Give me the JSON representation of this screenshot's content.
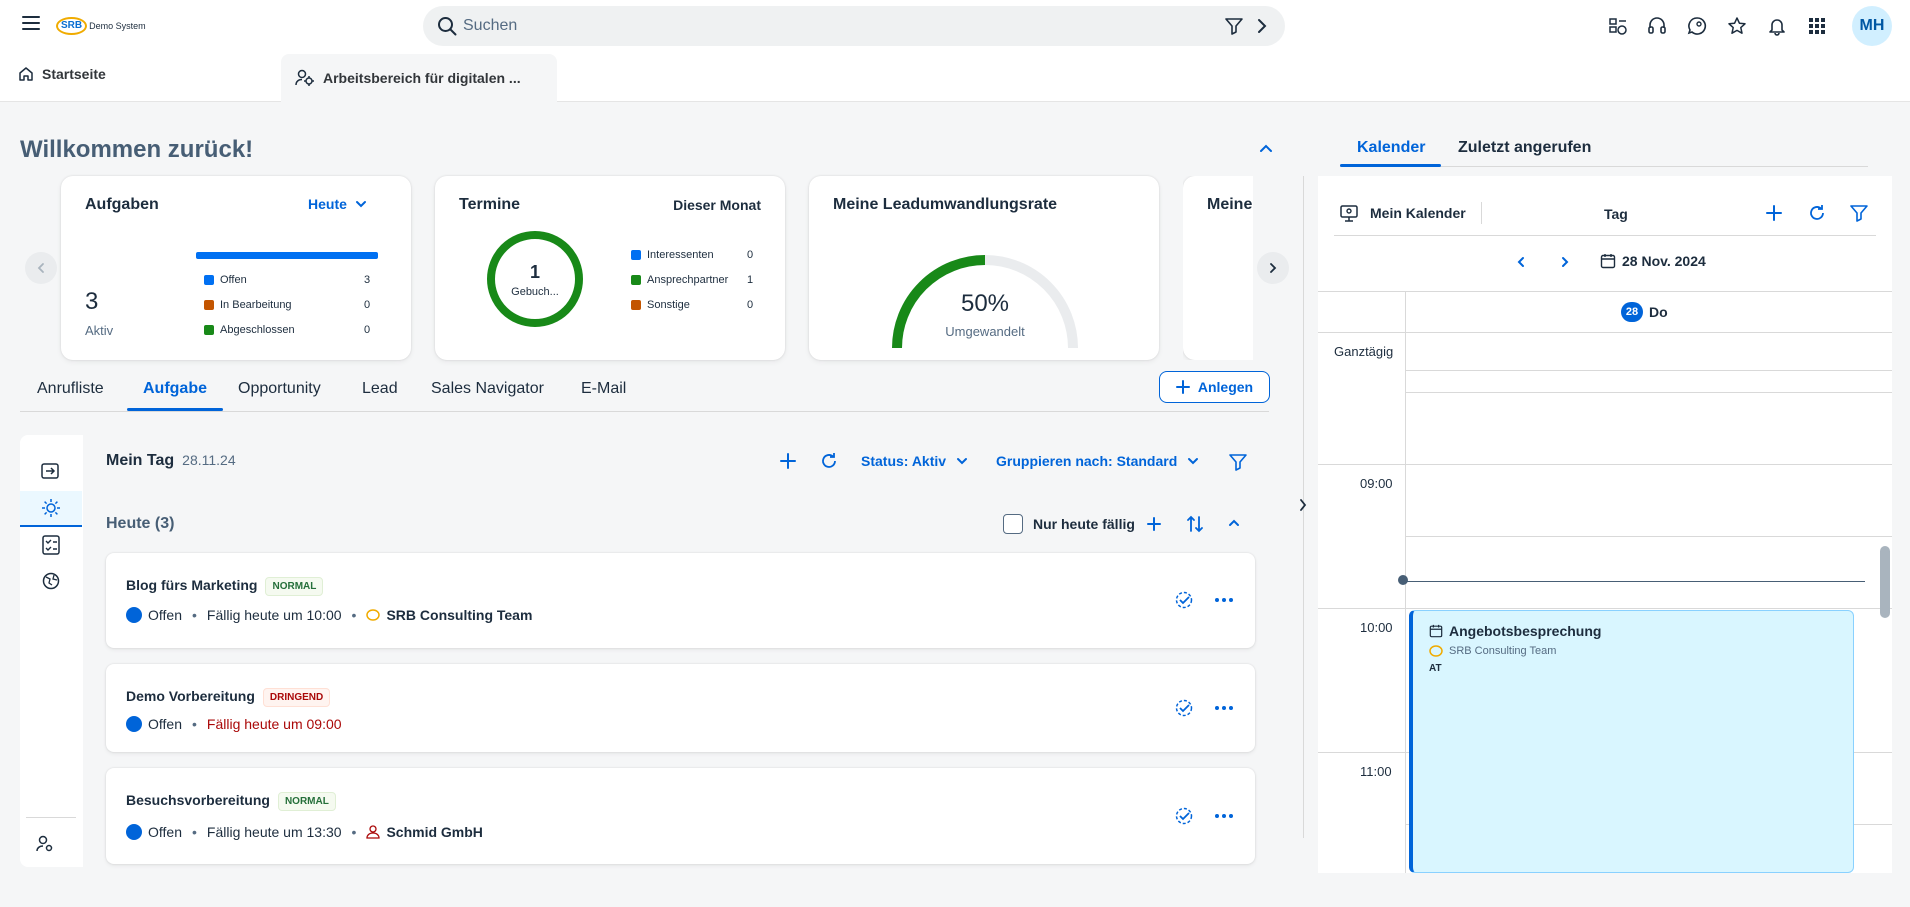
{
  "shell": {
    "logo_text": "SRB",
    "logo_sub": "Demo System",
    "search_placeholder": "Suchen",
    "avatar_initials": "MH",
    "icons": [
      "menu-icon",
      "filter-icon",
      "arrow-right-icon",
      "tasks-icon",
      "headset-icon",
      "feedback-icon",
      "star-icon",
      "bell-icon",
      "apps-grid-icon"
    ]
  },
  "tabs": {
    "home": "Startseite",
    "workspace": "Arbeitsbereich für digitalen ..."
  },
  "welcome": "Willkommen zurück!",
  "cards": {
    "tasks": {
      "title": "Aufgaben",
      "filter": "Heute",
      "count": "3",
      "count_label": "Aktiv",
      "legend": [
        {
          "label": "Offen",
          "value": "3",
          "color": "#0070f2"
        },
        {
          "label": "In Bearbeitung",
          "value": "0",
          "color": "#c35500"
        },
        {
          "label": "Abgeschlossen",
          "value": "0",
          "color": "#188918"
        }
      ],
      "bar_fraction": 1.0
    },
    "appointments": {
      "title": "Termine",
      "filter": "Dieser Monat",
      "center_value": "1",
      "center_label": "Gebuch...",
      "legend": [
        {
          "label": "Interessenten",
          "value": "0",
          "color": "#0070f2"
        },
        {
          "label": "Ansprechpartner",
          "value": "1",
          "color": "#188918"
        },
        {
          "label": "Sonstige",
          "value": "0",
          "color": "#c35500"
        }
      ]
    },
    "conversion": {
      "title": "Meine Leadumwandlungsrate",
      "percent": "50%",
      "label": "Umgewandelt",
      "fraction": 0.5
    },
    "more": {
      "title": "Meine"
    }
  },
  "subtabs": [
    "Anrufliste",
    "Aufgabe",
    "Opportunity",
    "Lead",
    "Sales Navigator",
    "E-Mail"
  ],
  "create_button": "Anlegen",
  "myday": {
    "title": "Mein Tag",
    "date": "28.11.24",
    "status": "Status: Aktiv",
    "group": "Gruppieren nach: Standard",
    "today_header": "Heute (3)",
    "only_due_today": "Nur heute fällig"
  },
  "tasks": [
    {
      "name": "Blog fürs Marketing",
      "priority": "NORMAL",
      "status": "Offen",
      "due": "Fällig heute um 10:00",
      "account": "SRB Consulting Team"
    },
    {
      "name": "Demo Vorbereitung",
      "priority": "DRINGEND",
      "status": "Offen",
      "due": "Fällig heute um 09:00",
      "account": ""
    },
    {
      "name": "Besuchsvorbereitung",
      "priority": "NORMAL",
      "status": "Offen",
      "due": "Fällig heute um 13:30",
      "account": "Schmid GmbH"
    }
  ],
  "right": {
    "tab_calendar": "Kalender",
    "tab_recent": "Zuletzt angerufen",
    "my_calendar": "Mein Kalender",
    "view": "Tag",
    "date": "28 Nov. 2024",
    "day_number": "28",
    "day_name": "Do",
    "all_day": "Ganztägig",
    "hours": [
      "09:00",
      "10:00",
      "11:00"
    ],
    "event": {
      "title": "Angebotsbesprechung",
      "subtitle": "SRB Consulting Team",
      "tag": "AT"
    }
  }
}
